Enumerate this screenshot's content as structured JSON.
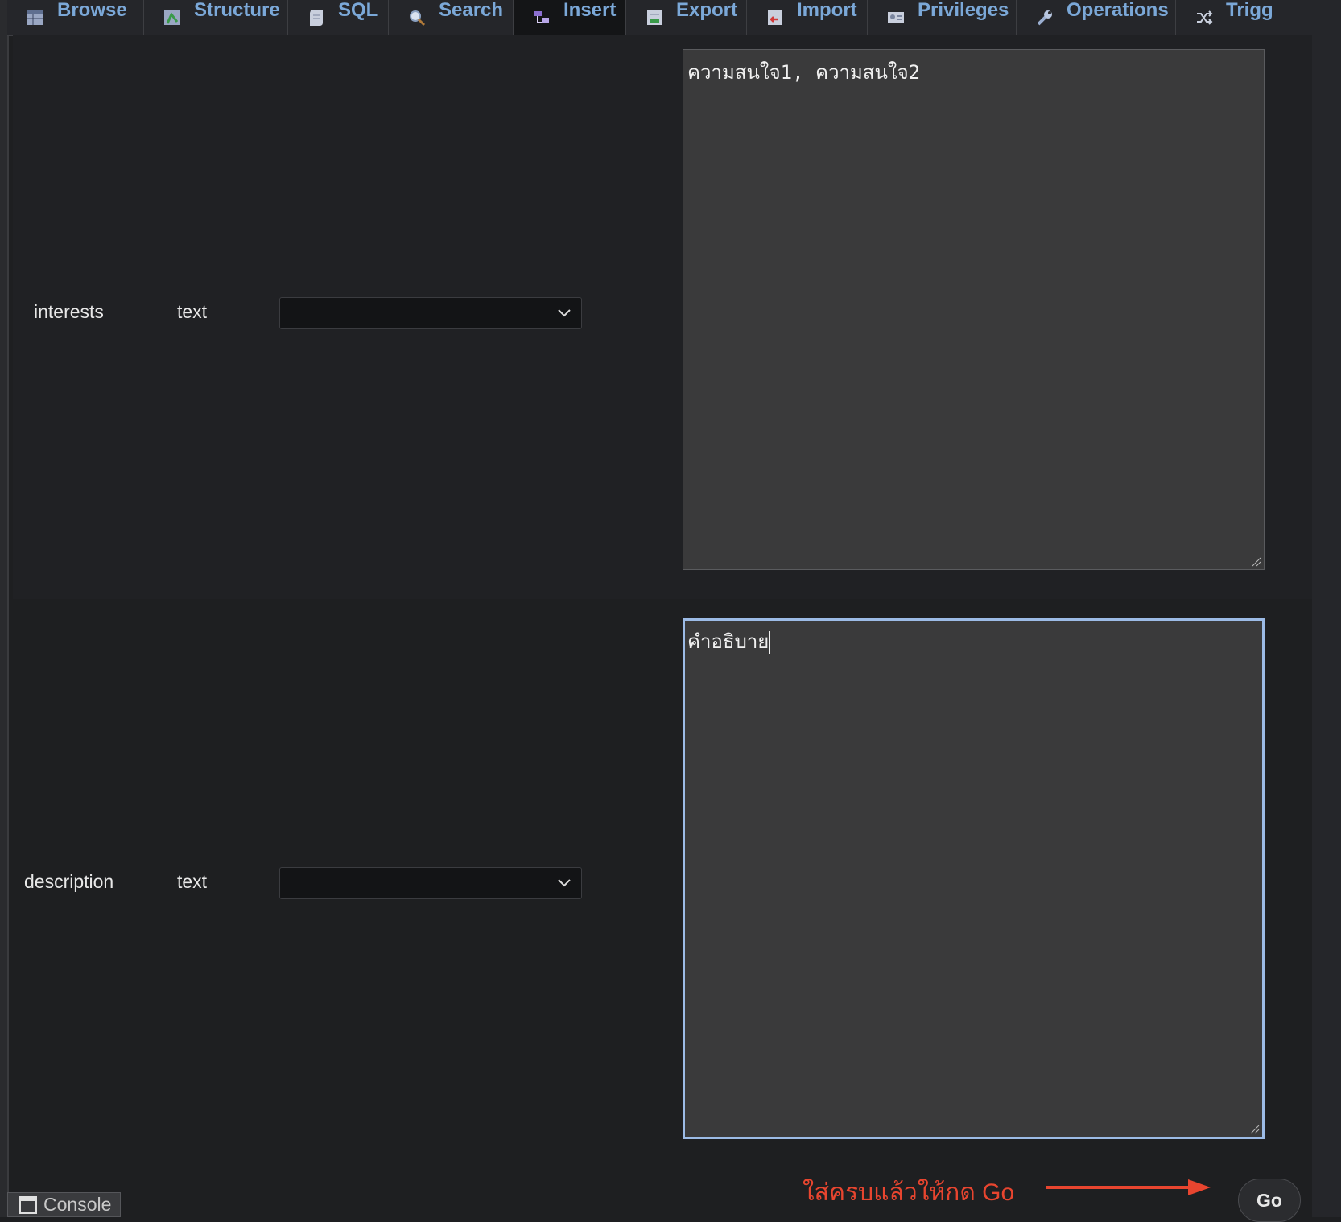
{
  "tabs": [
    {
      "label": "Browse",
      "icon": "table-icon",
      "active": false
    },
    {
      "label": "Structure",
      "icon": "structure-icon",
      "active": false
    },
    {
      "label": "SQL",
      "icon": "sql-icon",
      "active": false
    },
    {
      "label": "Search",
      "icon": "search-icon",
      "active": false
    },
    {
      "label": "Insert",
      "icon": "insert-icon",
      "active": true
    },
    {
      "label": "Export",
      "icon": "export-icon",
      "active": false
    },
    {
      "label": "Import",
      "icon": "import-icon",
      "active": false
    },
    {
      "label": "Privileges",
      "icon": "privileges-icon",
      "active": false
    },
    {
      "label": "Operations",
      "icon": "wrench-icon",
      "active": false
    },
    {
      "label": "Trigg",
      "icon": "triggers-icon",
      "active": false
    }
  ],
  "fields": [
    {
      "name": "interests",
      "type": "text",
      "function": "",
      "value": "ความสนใจ1, ความสนใจ2"
    },
    {
      "name": "description",
      "type": "text",
      "function": "",
      "value": "คำอธิบาย"
    }
  ],
  "annotation": {
    "text": "ใส่ครบแล้วให้กด Go",
    "color": "#e8452f"
  },
  "go_button": {
    "label": "Go"
  },
  "console": {
    "label": "Console"
  },
  "colors": {
    "tab_text": "#7ba8d8",
    "focus_border": "#9cbbe6",
    "annotation": "#e8452f"
  }
}
